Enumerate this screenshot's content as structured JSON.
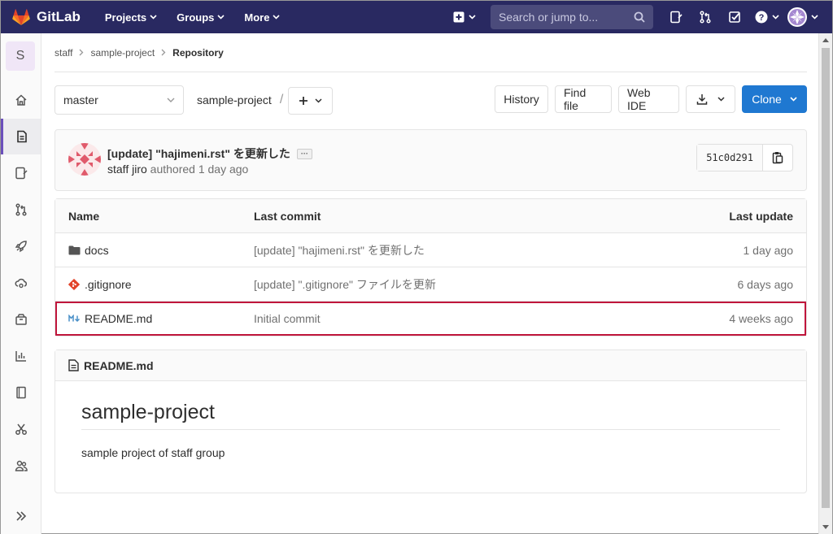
{
  "navbar": {
    "brand": "GitLab",
    "menus": [
      {
        "label": "Projects"
      },
      {
        "label": "Groups"
      },
      {
        "label": "More"
      }
    ],
    "search_placeholder": "Search or jump to..."
  },
  "sidebar": {
    "project_initial": "S"
  },
  "breadcrumb": {
    "items": [
      "staff",
      "sample-project",
      "Repository"
    ]
  },
  "toolbar": {
    "branch": "master",
    "path": "sample-project",
    "path_separator": "/",
    "history_label": "History",
    "find_file_label": "Find file",
    "web_ide_label": "Web IDE",
    "clone_label": "Clone"
  },
  "last_commit": {
    "title": "[update] \"hajimeni.rst\" を更新した",
    "ellipsis": "···",
    "author": "staff jiro",
    "action": "authored",
    "time": "1 day ago",
    "sha": "51c0d291"
  },
  "file_table": {
    "headers": {
      "name": "Name",
      "last_commit": "Last commit",
      "last_update": "Last update"
    },
    "rows": [
      {
        "name": "docs",
        "type": "folder-icon",
        "commit": "[update] \"hajimeni.rst\" を更新した",
        "updated": "1 day ago"
      },
      {
        "name": ".gitignore",
        "type": "git-icon",
        "commit": "[update] \".gitignore\" ファイルを更新",
        "updated": "6 days ago"
      },
      {
        "name": "README.md",
        "type": "markdown-icon",
        "commit": "Initial commit",
        "updated": "4 weeks ago",
        "highlighted": true
      }
    ]
  },
  "readme": {
    "filename": "README.md",
    "heading": "sample-project",
    "body": "sample project of staff group"
  },
  "colors": {
    "navbar": "#292961",
    "accent": "#1f78d1",
    "highlight": "#c0163c",
    "sidebar_active": "#6b4fbb"
  }
}
